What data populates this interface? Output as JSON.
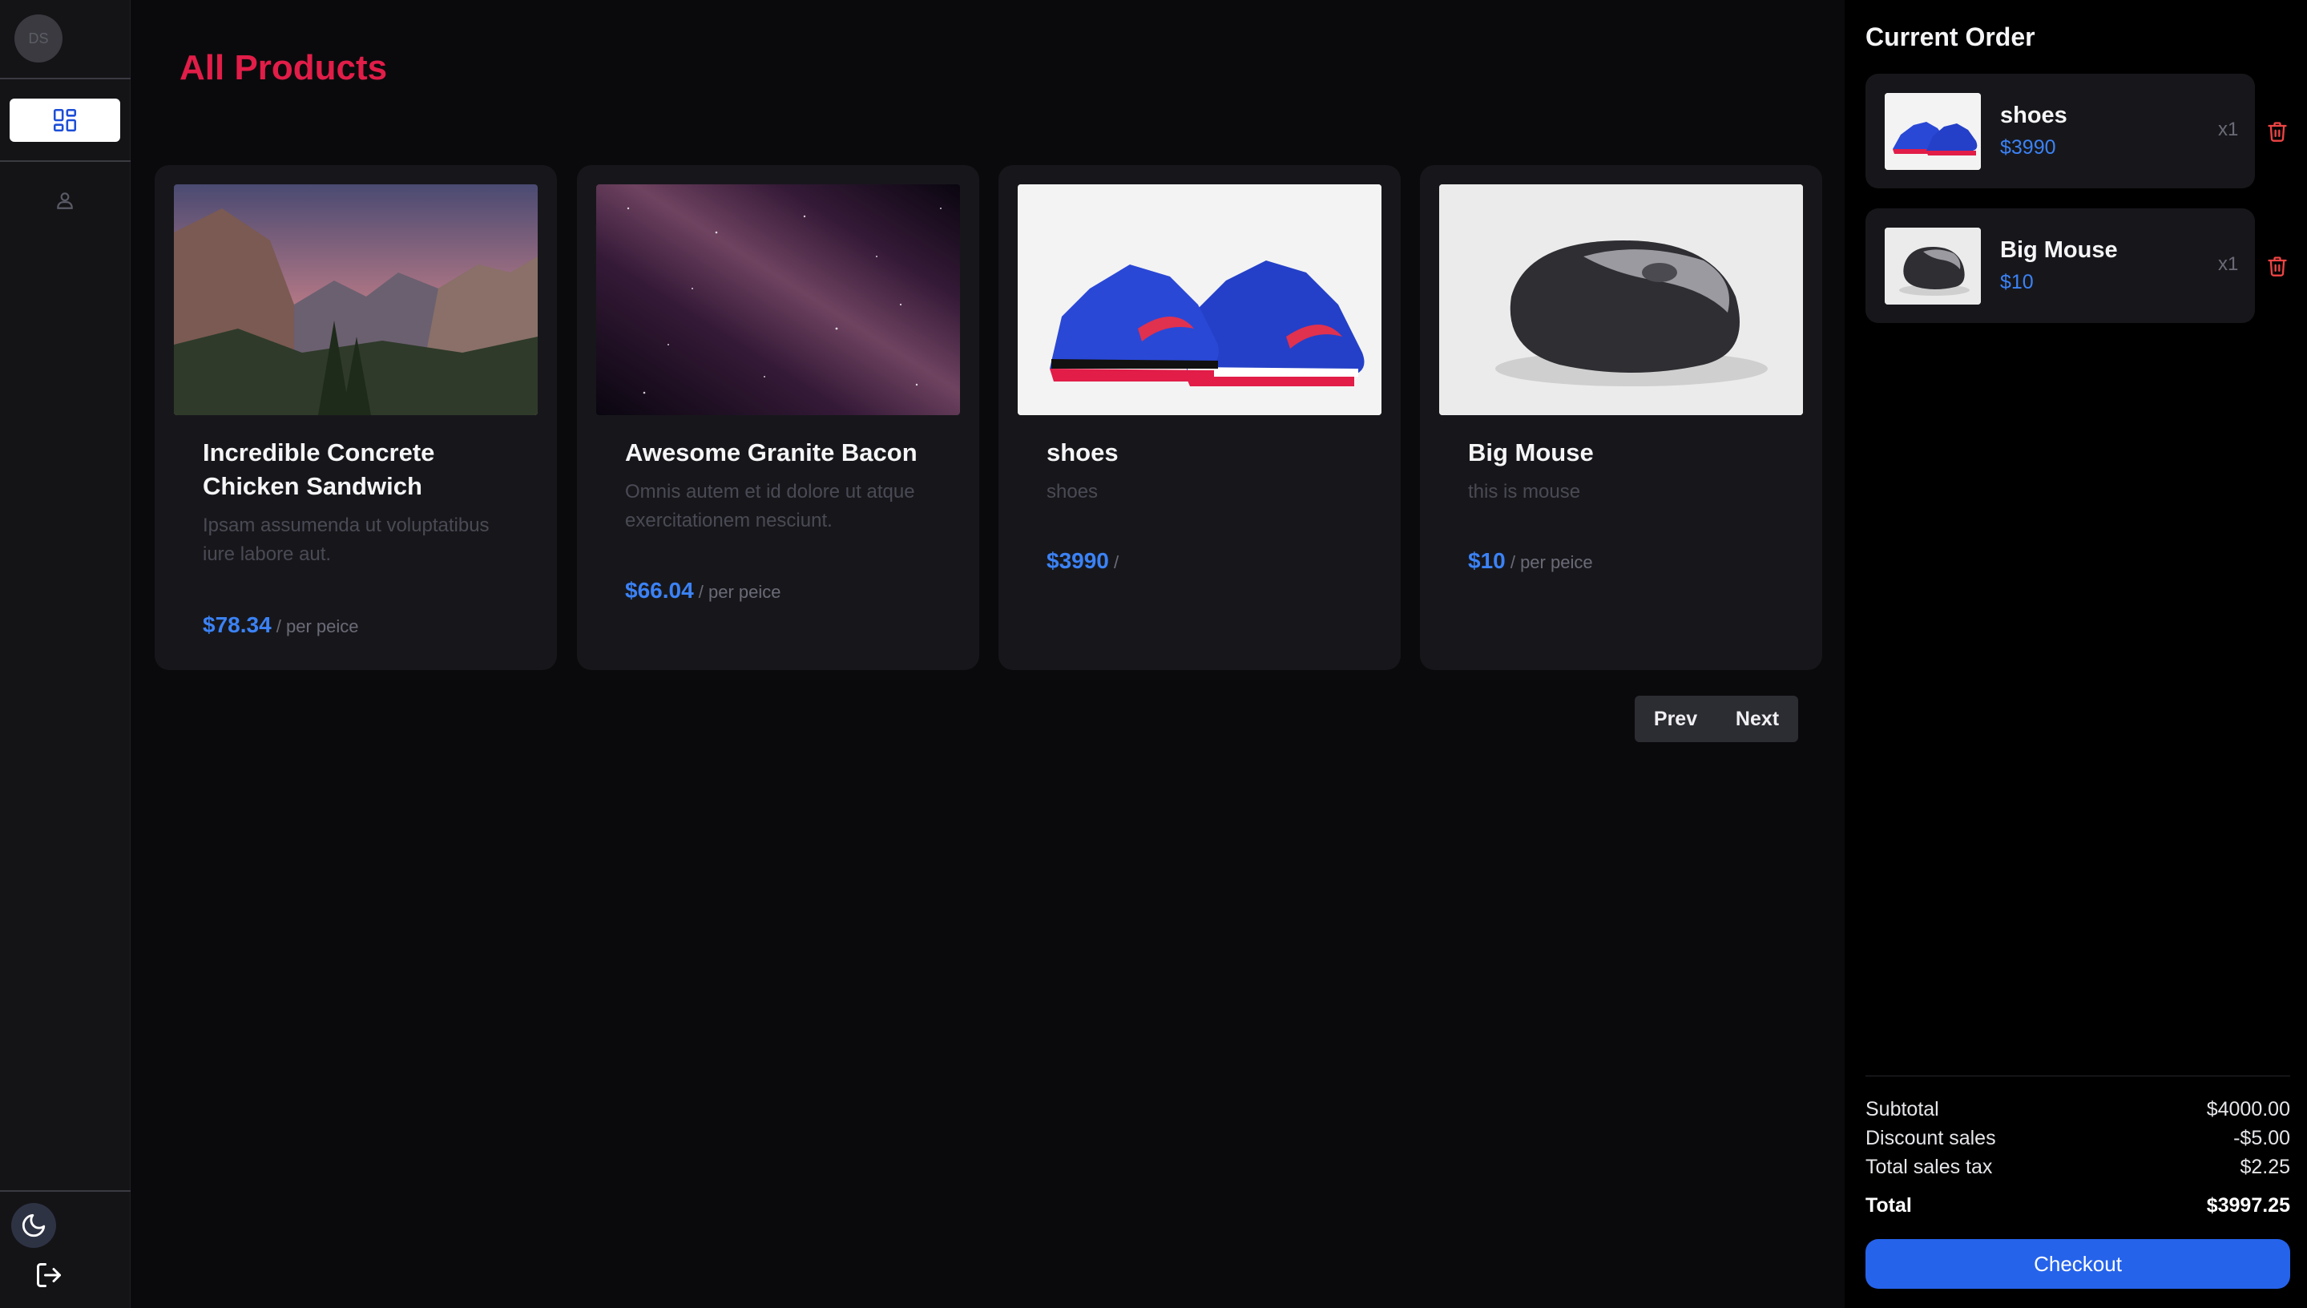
{
  "sidebar": {
    "avatar_initials": "DS",
    "nav": [
      {
        "id": "products",
        "icon": "dashboard-grid-icon",
        "active": true
      },
      {
        "id": "profile",
        "icon": "user-icon",
        "active": false
      }
    ],
    "theme_icon": "moon-icon",
    "logout_icon": "logout-icon"
  },
  "main": {
    "title": "All Products",
    "products": [
      {
        "title": "Incredible Concrete Chicken Sandwich",
        "description": "Ipsam assumenda ut voluptatibus iure labore aut.",
        "price": "$78.34",
        "unit": "/ per peice",
        "image": "mountain-landscape"
      },
      {
        "title": "Awesome Granite Bacon",
        "description": "Omnis autem et id dolore ut atque exercitationem nesciunt.",
        "price": "$66.04",
        "unit": "/ per peice",
        "image": "milky-way"
      },
      {
        "title": "shoes",
        "description": "shoes",
        "price": "$3990",
        "unit": "/",
        "image": "blue-sneakers"
      },
      {
        "title": "Big Mouse",
        "description": "this is mouse",
        "price": "$10",
        "unit": "/ per peice",
        "image": "computer-mouse"
      }
    ],
    "pagination": {
      "prev": "Prev",
      "next": "Next"
    }
  },
  "order": {
    "title": "Current Order",
    "items": [
      {
        "name": "shoes",
        "price": "$3990",
        "qty": "x1",
        "image": "blue-sneakers"
      },
      {
        "name": "Big Mouse",
        "price": "$10",
        "qty": "x1",
        "image": "computer-mouse"
      }
    ],
    "summary": {
      "subtotal_label": "Subtotal",
      "subtotal": "$4000.00",
      "discount_label": "Discount sales",
      "discount": "-$5.00",
      "tax_label": "Total sales tax",
      "tax": "$2.25",
      "total_label": "Total",
      "total": "$3997.25"
    },
    "checkout_label": "Checkout"
  },
  "colors": {
    "accent_title": "#e11d48",
    "price_blue": "#3b82f6",
    "checkout_blue": "#2563eb",
    "delete_red": "#ef4444"
  }
}
